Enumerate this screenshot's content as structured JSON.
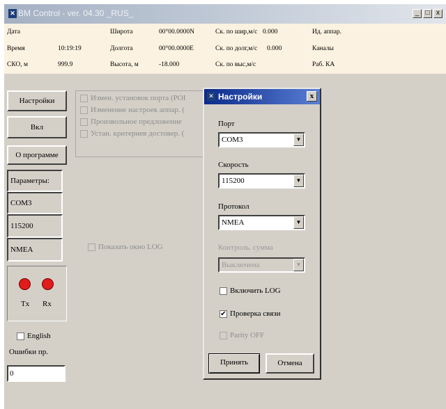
{
  "window": {
    "title": "BM Control - ver. 04.30 _RUS_",
    "icon": "satellite-icon",
    "controls": [
      "_",
      "□",
      "x"
    ]
  },
  "info": [
    {
      "label": "Дата",
      "value": ""
    },
    {
      "label": "Время",
      "value": "10:19:19"
    },
    {
      "label": "СКО, м",
      "value": "999.9"
    },
    {
      "label": "Широта",
      "value": "00°00.0000N"
    },
    {
      "label": "Долгота",
      "value": "00°00.0000E"
    },
    {
      "label": "Высота, м",
      "value": "-18.000"
    },
    {
      "label": "Ск. по шир,м/с",
      "value": "0.000"
    },
    {
      "label": "Ск. по долг,м/с",
      "value": "0.000"
    },
    {
      "label": "Ск. по выс,м/с",
      "value": ""
    },
    {
      "label": "Ид. аппар.",
      "value": ""
    },
    {
      "label": "Каналы",
      "value": ""
    },
    {
      "label": "Раб. КА",
      "value": ""
    }
  ],
  "left": {
    "settings_button": "Настройки",
    "on_button": "Вкл",
    "about_button": "О программе",
    "params_label": "Параметры:",
    "param_port": "COM3",
    "param_speed": "115200",
    "param_protocol": "NMEA",
    "tx_label": "Tx",
    "rx_label": "Rx",
    "english_label": "English",
    "errors_label": "Ошибки пр.",
    "errors_value": "0"
  },
  "options": [
    "Измен. установок порта (POI",
    "Изменение настроек аппар. (",
    "Произвольное предложение",
    "Устан. критериев достовер. ("
  ],
  "show_log_label": "Показать окно LOG",
  "dialog": {
    "title": "Настройки",
    "port_label": "Порт",
    "port_value": "COM3",
    "speed_label": "Скорость",
    "speed_value": "115200",
    "protocol_label": "Протокол",
    "protocol_value": "NMEA",
    "checksum_label": "Контроль. сумма",
    "checksum_value": "Выключена",
    "enable_log_label": "Включить LOG",
    "check_link_label": "Проверка связи",
    "check_link_mark": "✔",
    "parity_label": "Parity OFF",
    "accept_button": "Принять",
    "cancel_button": "Отмена"
  }
}
